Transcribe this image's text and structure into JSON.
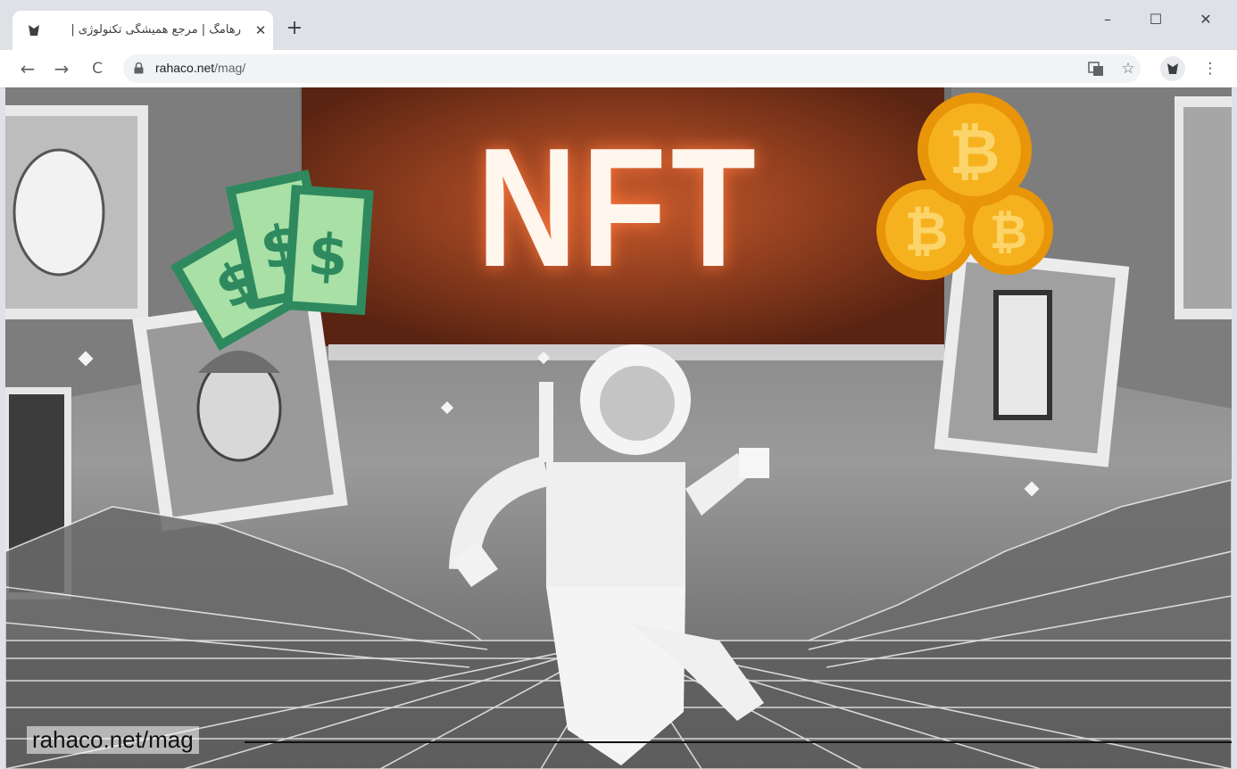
{
  "browser": {
    "tab": {
      "title": "رهامگ | مرجع همیشگی تکنولوژی |",
      "close": "✕"
    },
    "new_tab": "+",
    "window_controls": {
      "minimize": "–",
      "maximize": "☐",
      "close": "✕"
    },
    "nav": {
      "back": "←",
      "forward": "→",
      "reload": "C"
    },
    "address": {
      "host": "rahaco.net",
      "path": "/mag/"
    },
    "icons": {
      "translate": "translate-icon",
      "bookmark": "☆",
      "menu": "⋮"
    }
  },
  "page": {
    "hero_title": "NFT",
    "caption": "rahaco.net/mag",
    "colors": {
      "banner": "#8a3a1e",
      "dollar_green": "#2e8a5e",
      "bill_face": "#a8e0a6",
      "coin_gold": "#f6a814"
    }
  }
}
